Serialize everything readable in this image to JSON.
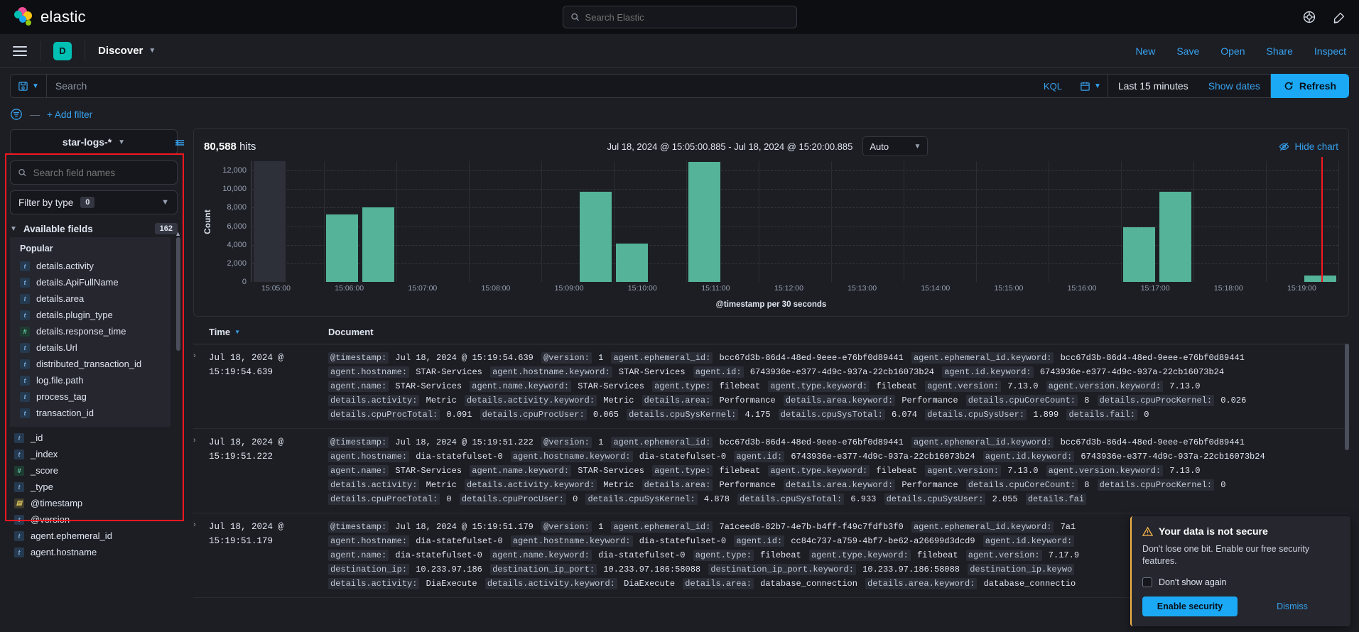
{
  "global_header": {
    "brand": "elastic",
    "search_placeholder": "Search Elastic",
    "icons": [
      "help-icon",
      "announcements-icon"
    ]
  },
  "app_header": {
    "app_badge": "D",
    "title": "Discover",
    "actions": [
      "New",
      "Save",
      "Open",
      "Share",
      "Inspect"
    ]
  },
  "query_bar": {
    "search_placeholder": "Search",
    "language": "KQL",
    "time_range": "Last 15 minutes",
    "show_dates": "Show dates",
    "refresh": "Refresh"
  },
  "filter_bar": {
    "add_filter": "+ Add filter"
  },
  "sidebar": {
    "index_pattern": "star-logs-*",
    "field_search_placeholder": "Search field names",
    "filter_by_type_label": "Filter by type",
    "filter_by_type_count": "0",
    "available_fields_label": "Available fields",
    "available_fields_count": "162",
    "popular_label": "Popular",
    "popular_fields": [
      {
        "name": "details.activity",
        "type": "t"
      },
      {
        "name": "details.ApiFullName",
        "type": "t"
      },
      {
        "name": "details.area",
        "type": "t"
      },
      {
        "name": "details.plugin_type",
        "type": "t"
      },
      {
        "name": "details.response_time",
        "type": "n"
      },
      {
        "name": "details.Url",
        "type": "t"
      },
      {
        "name": "distributed_transaction_id",
        "type": "t"
      },
      {
        "name": "log.file.path",
        "type": "t"
      },
      {
        "name": "process_tag",
        "type": "t"
      },
      {
        "name": "transaction_id",
        "type": "t"
      }
    ],
    "root_fields": [
      {
        "name": "_id",
        "type": "t"
      },
      {
        "name": "_index",
        "type": "t"
      },
      {
        "name": "_score",
        "type": "n"
      },
      {
        "name": "_type",
        "type": "t"
      },
      {
        "name": "@timestamp",
        "type": "d"
      },
      {
        "name": "@version",
        "type": "t"
      },
      {
        "name": "agent.ephemeral_id",
        "type": "t"
      },
      {
        "name": "agent.hostname",
        "type": "t"
      }
    ]
  },
  "chart_panel": {
    "hits_count": "80,588",
    "hits_label": "hits",
    "time_range_label": "Jul 18, 2024 @ 15:05:00.885 - Jul 18, 2024 @ 15:20:00.885",
    "interval": "Auto",
    "hide_chart": "Hide chart"
  },
  "chart_data": {
    "type": "bar",
    "title": "",
    "xlabel": "@timestamp per 30 seconds",
    "ylabel": "Count",
    "ylim": [
      0,
      13000
    ],
    "yticks": [
      0,
      2000,
      4000,
      6000,
      8000,
      10000,
      12000
    ],
    "ytick_labels": [
      "0",
      "2,000",
      "4,000",
      "6,000",
      "8,000",
      "10,000",
      "12,000"
    ],
    "xtick_labels": [
      "15:05:00",
      "15:06:00",
      "15:07:00",
      "15:08:00",
      "15:09:00",
      "15:10:00",
      "15:11:00",
      "15:12:00",
      "15:13:00",
      "15:14:00",
      "15:15:00",
      "15:16:00",
      "15:17:00",
      "15:18:00",
      "15:19:00"
    ],
    "grid": true,
    "legend": "none",
    "bar_color": "#54b399",
    "ghost_color": "#2d3038",
    "categories": [
      "15:05:00",
      "15:05:30",
      "15:06:00",
      "15:06:30",
      "15:07:00",
      "15:07:30",
      "15:08:00",
      "15:08:30",
      "15:09:00",
      "15:09:30",
      "15:10:00",
      "15:10:30",
      "15:11:00",
      "15:11:30",
      "15:12:00",
      "15:12:30",
      "15:13:00",
      "15:13:30",
      "15:14:00",
      "15:14:30",
      "15:15:00",
      "15:15:30",
      "15:16:00",
      "15:16:30",
      "15:17:00",
      "15:17:30",
      "15:18:00",
      "15:18:30",
      "15:19:00",
      "15:19:30"
    ],
    "values": [
      13000,
      0,
      7300,
      8050,
      0,
      0,
      0,
      0,
      0,
      9700,
      4150,
      0,
      12900,
      0,
      0,
      0,
      0,
      0,
      0,
      0,
      0,
      0,
      0,
      0,
      5900,
      9700,
      0,
      0,
      0,
      700
    ],
    "ghost_index": 0,
    "cursor_marker": {
      "label": "now",
      "color": "#f5171f"
    }
  },
  "documents_table": {
    "columns": [
      "Time",
      "Document"
    ],
    "rows": [
      {
        "time": "Jul 18, 2024 @ 15:19:54.639",
        "lines": [
          [
            {
              "k": "@timestamp:",
              "v": "Jul 18, 2024 @ 15:19:54.639"
            },
            {
              "k": "@version:",
              "v": "1"
            },
            {
              "k": "agent.ephemeral_id:",
              "v": "bcc67d3b-86d4-48ed-9eee-e76bf0d89441"
            },
            {
              "k": "agent.ephemeral_id.keyword:",
              "v": "bcc67d3b-86d4-48ed-9eee-e76bf0d89441"
            }
          ],
          [
            {
              "k": "agent.hostname:",
              "v": "STAR-Services"
            },
            {
              "k": "agent.hostname.keyword:",
              "v": "STAR-Services"
            },
            {
              "k": "agent.id:",
              "v": "6743936e-e377-4d9c-937a-22cb16073b24"
            },
            {
              "k": "agent.id.keyword:",
              "v": "6743936e-e377-4d9c-937a-22cb16073b24"
            }
          ],
          [
            {
              "k": "agent.name:",
              "v": "STAR-Services"
            },
            {
              "k": "agent.name.keyword:",
              "v": "STAR-Services"
            },
            {
              "k": "agent.type:",
              "v": "filebeat"
            },
            {
              "k": "agent.type.keyword:",
              "v": "filebeat"
            },
            {
              "k": "agent.version:",
              "v": "7.13.0"
            },
            {
              "k": "agent.version.keyword:",
              "v": "7.13.0"
            }
          ],
          [
            {
              "k": "details.activity:",
              "v": "Metric"
            },
            {
              "k": "details.activity.keyword:",
              "v": "Metric"
            },
            {
              "k": "details.area:",
              "v": "Performance"
            },
            {
              "k": "details.area.keyword:",
              "v": "Performance"
            },
            {
              "k": "details.cpuCoreCount:",
              "v": "8"
            },
            {
              "k": "details.cpuProcKernel:",
              "v": "0.026"
            }
          ],
          [
            {
              "k": "details.cpuProcTotal:",
              "v": "0.091"
            },
            {
              "k": "details.cpuProcUser:",
              "v": "0.065"
            },
            {
              "k": "details.cpuSysKernel:",
              "v": "4.175"
            },
            {
              "k": "details.cpuSysTotal:",
              "v": "6.074"
            },
            {
              "k": "details.cpuSysUser:",
              "v": "1.899"
            },
            {
              "k": "details.fail:",
              "v": "0"
            }
          ]
        ]
      },
      {
        "time": "Jul 18, 2024 @ 15:19:51.222",
        "lines": [
          [
            {
              "k": "@timestamp:",
              "v": "Jul 18, 2024 @ 15:19:51.222"
            },
            {
              "k": "@version:",
              "v": "1"
            },
            {
              "k": "agent.ephemeral_id:",
              "v": "bcc67d3b-86d4-48ed-9eee-e76bf0d89441"
            },
            {
              "k": "agent.ephemeral_id.keyword:",
              "v": "bcc67d3b-86d4-48ed-9eee-e76bf0d89441"
            }
          ],
          [
            {
              "k": "agent.hostname:",
              "v": "dia-statefulset-0"
            },
            {
              "k": "agent.hostname.keyword:",
              "v": "dia-statefulset-0"
            },
            {
              "k": "agent.id:",
              "v": "6743936e-e377-4d9c-937a-22cb16073b24"
            },
            {
              "k": "agent.id.keyword:",
              "v": "6743936e-e377-4d9c-937a-22cb16073b24"
            }
          ],
          [
            {
              "k": "agent.name:",
              "v": "STAR-Services"
            },
            {
              "k": "agent.name.keyword:",
              "v": "STAR-Services"
            },
            {
              "k": "agent.type:",
              "v": "filebeat"
            },
            {
              "k": "agent.type.keyword:",
              "v": "filebeat"
            },
            {
              "k": "agent.version:",
              "v": "7.13.0"
            },
            {
              "k": "agent.version.keyword:",
              "v": "7.13.0"
            }
          ],
          [
            {
              "k": "details.activity:",
              "v": "Metric"
            },
            {
              "k": "details.activity.keyword:",
              "v": "Metric"
            },
            {
              "k": "details.area:",
              "v": "Performance"
            },
            {
              "k": "details.area.keyword:",
              "v": "Performance"
            },
            {
              "k": "details.cpuCoreCount:",
              "v": "8"
            },
            {
              "k": "details.cpuProcKernel:",
              "v": "0"
            }
          ],
          [
            {
              "k": "details.cpuProcTotal:",
              "v": "0"
            },
            {
              "k": "details.cpuProcUser:",
              "v": "0"
            },
            {
              "k": "details.cpuSysKernel:",
              "v": "4.878"
            },
            {
              "k": "details.cpuSysTotal:",
              "v": "6.933"
            },
            {
              "k": "details.cpuSysUser:",
              "v": "2.055"
            },
            {
              "k": "details.fai",
              "v": ""
            }
          ]
        ]
      },
      {
        "time": "Jul 18, 2024 @ 15:19:51.179",
        "lines": [
          [
            {
              "k": "@timestamp:",
              "v": "Jul 18, 2024 @ 15:19:51.179"
            },
            {
              "k": "@version:",
              "v": "1"
            },
            {
              "k": "agent.ephemeral_id:",
              "v": "7a1ceed8-82b7-4e7b-b4ff-f49c7fdfb3f0"
            },
            {
              "k": "agent.ephemeral_id.keyword:",
              "v": "7a1"
            }
          ],
          [
            {
              "k": "agent.hostname:",
              "v": "dia-statefulset-0"
            },
            {
              "k": "agent.hostname.keyword:",
              "v": "dia-statefulset-0"
            },
            {
              "k": "agent.id:",
              "v": "cc84c737-a759-4bf7-be62-a26699d3dcd9"
            },
            {
              "k": "agent.id.keyword:",
              "v": ""
            }
          ],
          [
            {
              "k": "agent.name:",
              "v": "dia-statefulset-0"
            },
            {
              "k": "agent.name.keyword:",
              "v": "dia-statefulset-0"
            },
            {
              "k": "agent.type:",
              "v": "filebeat"
            },
            {
              "k": "agent.type.keyword:",
              "v": "filebeat"
            },
            {
              "k": "agent.version:",
              "v": "7.17.9"
            }
          ],
          [
            {
              "k": "destination_ip:",
              "v": "10.233.97.186"
            },
            {
              "k": "destination_ip_port:",
              "v": "10.233.97.186:58088"
            },
            {
              "k": "destination_ip_port.keyword:",
              "v": "10.233.97.186:58088"
            },
            {
              "k": "destination_ip.keywo",
              "v": ""
            }
          ],
          [
            {
              "k": "details.activity:",
              "v": "DiaExecute"
            },
            {
              "k": "details.activity.keyword:",
              "v": "DiaExecute"
            },
            {
              "k": "details.area:",
              "v": "database_connection"
            },
            {
              "k": "details.area.keyword:",
              "v": "database_connectio"
            }
          ]
        ]
      }
    ]
  },
  "toast": {
    "title": "Your data is not secure",
    "body": "Don't lose one bit. Enable our free security features.",
    "checkbox_label": "Don't show again",
    "primary_button": "Enable security",
    "secondary_button": "Dismiss"
  }
}
